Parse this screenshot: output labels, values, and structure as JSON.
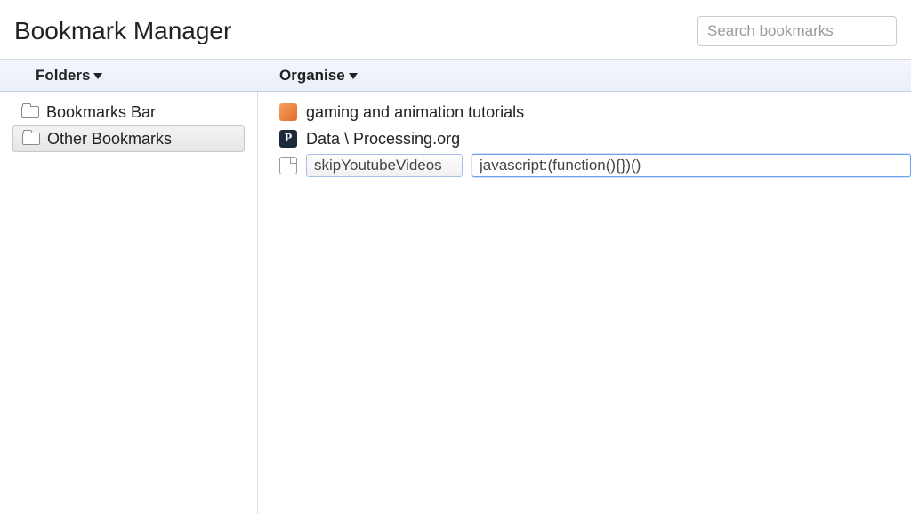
{
  "header": {
    "title": "Bookmark Manager",
    "search_placeholder": "Search bookmarks"
  },
  "toolbar": {
    "folders_label": "Folders",
    "organise_label": "Organise"
  },
  "sidebar": {
    "folders": [
      {
        "label": "Bookmarks Bar",
        "selected": false
      },
      {
        "label": "Other Bookmarks",
        "selected": true
      }
    ]
  },
  "bookmarks": [
    {
      "icon": "orange",
      "icon_letter": "",
      "title": "gaming and animation tutorials"
    },
    {
      "icon": "dark",
      "icon_letter": "P",
      "title": "Data \\ Processing.org"
    }
  ],
  "edit_row": {
    "name_value": "skipYoutubeVideos",
    "url_value": "javascript:(function(){})()"
  }
}
